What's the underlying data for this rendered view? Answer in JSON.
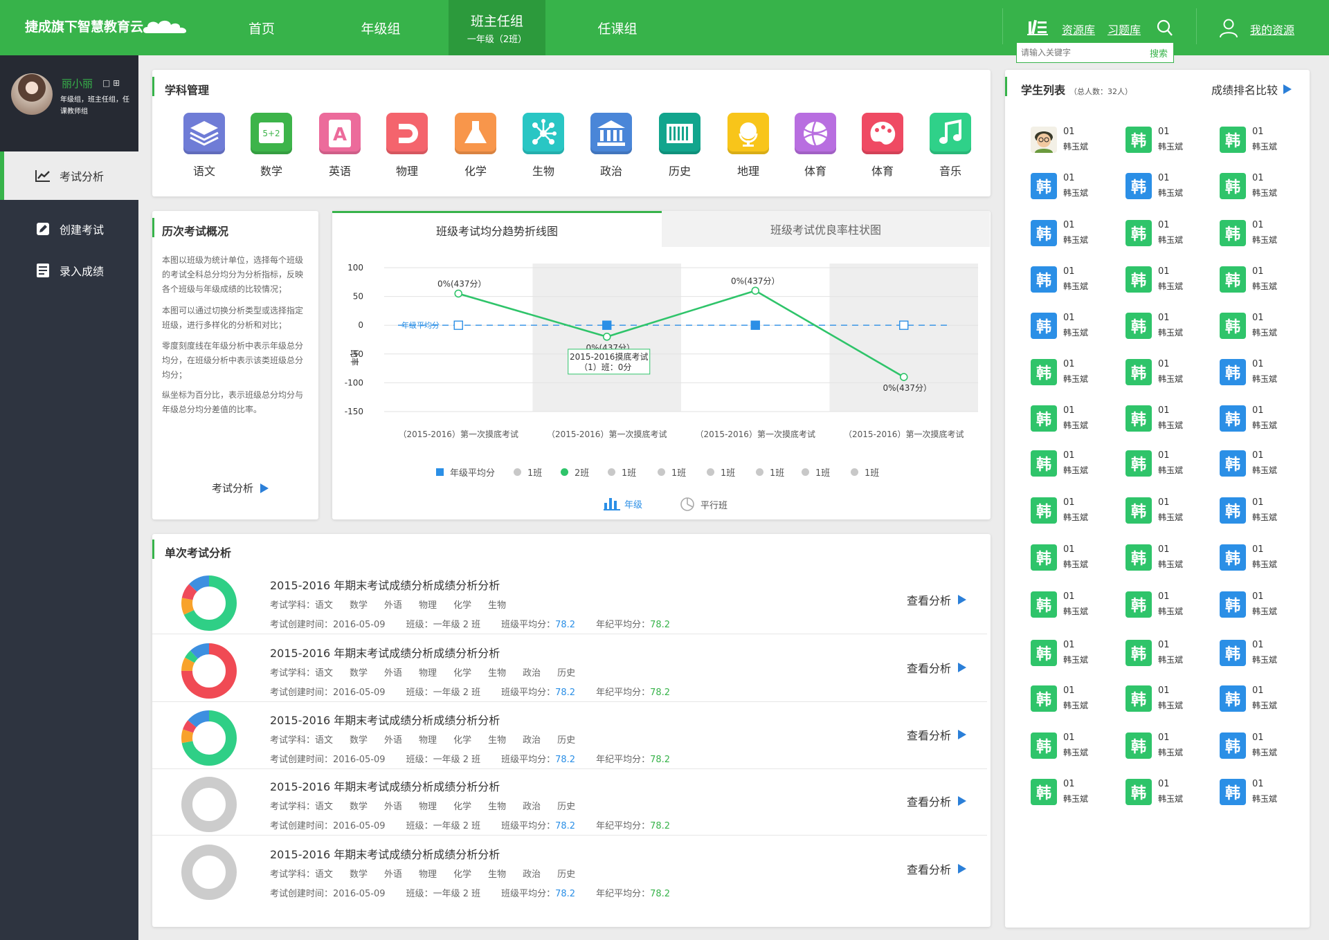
{
  "header": {
    "brand": "捷成旗下智慧教育云",
    "nav": [
      {
        "label": "首页"
      },
      {
        "label": "年级组"
      },
      {
        "label": "班主任组",
        "sub": "一年级（2班）"
      },
      {
        "label": "任课组"
      }
    ],
    "resource_library": "资源库",
    "exercise_library": "习题库",
    "my_resources": "我的资源",
    "search_placeholder": "请输入关键字",
    "search_button": "搜索"
  },
  "sidebar": {
    "user_name": "丽小丽",
    "user_roles": "年级组，班主任组，任课教师组",
    "menu": [
      {
        "label": "考试分析",
        "icon": "trend-chart-icon"
      },
      {
        "label": "创建考试",
        "icon": "edit-icon"
      },
      {
        "label": "录入成绩",
        "icon": "list-icon"
      }
    ]
  },
  "subjects": {
    "title": "学科管理",
    "items": [
      {
        "label": "语文",
        "color": "#6f7cd6"
      },
      {
        "label": "数学",
        "color": "#3db44a"
      },
      {
        "label": "英语",
        "color": "#ec6b9b"
      },
      {
        "label": "物理",
        "color": "#f4646d"
      },
      {
        "label": "化学",
        "color": "#f8964b"
      },
      {
        "label": "生物",
        "color": "#29c6c4"
      },
      {
        "label": "政治",
        "color": "#4a86d8"
      },
      {
        "label": "历史",
        "color": "#12a58d"
      },
      {
        "label": "地理",
        "color": "#f8c51a"
      },
      {
        "label": "体育",
        "color": "#b86ee0"
      },
      {
        "label": "体育",
        "color": "#ef4a63"
      },
      {
        "label": "音乐",
        "color": "#2fd189"
      }
    ]
  },
  "history": {
    "title": "历次考试概况",
    "paragraphs": [
      "本图以班级为统计单位，选择每个班级的考试全科总分均分为分析指标，反映各个班级与年级成绩的比较情况；",
      "本图可以通过切换分析类型或选择指定班级，进行多样化的分析和对比；",
      "零度刻度线在年级分析中表示年级总分均分，在班级分析中表示该类班级总分均分；",
      "纵坐标为百分比，表示班级总分均分与年级总分均分差值的比率。"
    ],
    "link": "考试分析"
  },
  "chart_tabs": [
    "班级考试均分趋势折线图",
    "班级考试优良率柱状图"
  ],
  "chart_data": {
    "type": "line",
    "categories": [
      "（2015-2016）第一次摸底考试",
      "（2015-2016）第一次摸底考试",
      "（2015-2016）第一次摸底考试",
      "（2015-2016）第一次摸底考试"
    ],
    "ylabel": "比率",
    "ylim": [
      -150,
      100
    ],
    "yticks": [
      100,
      50,
      0,
      -50,
      -100,
      -150
    ],
    "series": [
      {
        "name": "年级平均分",
        "values": [
          0,
          0,
          0,
          0
        ],
        "color": "#2b8fe6"
      },
      {
        "name": "2班",
        "values": [
          55,
          -20,
          60,
          -90
        ],
        "color": "#2fc46a"
      }
    ],
    "point_labels": [
      "0%(437分）",
      "0%(437分）",
      "0%(437分）",
      "0%(437分）"
    ],
    "line_label": "年级平均分",
    "tooltip": {
      "title": "2015-2016摸底考试",
      "body": "（1）班：0分"
    },
    "legend": [
      "年级平均分",
      "1班",
      "2班",
      "1班",
      "1班",
      "1班",
      "1班",
      "1班",
      "1班"
    ],
    "toggles": [
      "年级",
      "平行班"
    ]
  },
  "single": {
    "title": "单次考试分析",
    "link": "查看分析",
    "exams": [
      {
        "title": "2015-2016 年期末考试成绩分析成绩分析分析",
        "subjects": [
          "考试学科：语文",
          "数学",
          "外语",
          "物理",
          "化学",
          "生物"
        ],
        "date": "考试创建时间：2016-05-09",
        "cls": "班级：一年级 2 班",
        "class_avg_label": "班级平均分：",
        "class_avg": "78.2",
        "grade_avg_label": "年纪平均分：",
        "grade_avg": "78.2",
        "segments": [
          {
            "v": 0.68,
            "c": "#2fcf86"
          },
          {
            "v": 0.1,
            "c": "#f8a22b"
          },
          {
            "v": 0.09,
            "c": "#ef4a5a"
          },
          {
            "v": 0.13,
            "c": "#3d8fe0"
          }
        ]
      },
      {
        "title": "2015-2016 年期末考试成绩分析成绩分析分析",
        "subjects": [
          "考试学科：语文",
          "数学",
          "外语",
          "物理",
          "化学",
          "生物",
          "政治",
          "历史"
        ],
        "date": "考试创建时间：2016-05-09",
        "cls": "班级：一年级 2 班",
        "class_avg_label": "班级平均分：",
        "class_avg": "78.2",
        "grade_avg_label": "年纪平均分：",
        "grade_avg": "78.2",
        "segments": [
          {
            "v": 0.75,
            "c": "#f04a54"
          },
          {
            "v": 0.08,
            "c": "#f8a22b"
          },
          {
            "v": 0.05,
            "c": "#2fcf86"
          },
          {
            "v": 0.12,
            "c": "#3d8fe0"
          }
        ]
      },
      {
        "title": "2015-2016 年期末考试成绩分析成绩分析分析",
        "subjects": [
          "考试学科：语文",
          "数学",
          "外语",
          "物理",
          "化学",
          "生物",
          "政治",
          "历史"
        ],
        "date": "考试创建时间：2016-05-09",
        "cls": "班级：一年级 2 班",
        "class_avg_label": "班级平均分：",
        "class_avg": "78.2",
        "grade_avg_label": "年纪平均分：",
        "grade_avg": "78.2",
        "segments": [
          {
            "v": 0.72,
            "c": "#2fcf86"
          },
          {
            "v": 0.08,
            "c": "#f8a22b"
          },
          {
            "v": 0.06,
            "c": "#ef4a5a"
          },
          {
            "v": 0.14,
            "c": "#3d8fe0"
          }
        ]
      },
      {
        "title": "2015-2016 年期末考试成绩分析成绩分析分析",
        "subjects": [
          "考试学科：语文",
          "数学",
          "外语",
          "物理",
          "化学",
          "生物",
          "政治",
          "历史"
        ],
        "date": "考试创建时间：2016-05-09",
        "cls": "班级：一年级 2 班",
        "class_avg_label": "班级平均分：",
        "class_avg": "78.2",
        "grade_avg_label": "年纪平均分：",
        "grade_avg": "78.2",
        "segments": [
          {
            "v": 1,
            "c": "#cccccc"
          }
        ]
      },
      {
        "title": "2015-2016 年期末考试成绩分析成绩分析分析",
        "subjects": [
          "考试学科：语文",
          "数学",
          "外语",
          "物理",
          "化学",
          "生物",
          "政治",
          "历史"
        ],
        "date": "考试创建时间：2016-05-09",
        "cls": "班级：一年级 2 班",
        "class_avg_label": "班级平均分：",
        "class_avg": "78.2",
        "grade_avg_label": "年纪平均分：",
        "grade_avg": "78.2",
        "segments": [
          {
            "v": 1,
            "c": "#cccccc"
          }
        ]
      }
    ]
  },
  "students": {
    "title": "学生列表",
    "count": "（总人数：32人）",
    "compare": "成绩排名比较",
    "avatar_char": "韩",
    "number": "01",
    "name": "韩玉斌",
    "colors": [
      "photo",
      "#2fc46a",
      "#2fc46a",
      "#2b8fe6",
      "#2b8fe6",
      "#2fc46a",
      "#2b8fe6",
      "#2fc46a",
      "#2fc46a",
      "#2b8fe6",
      "#2fc46a",
      "#2fc46a",
      "#2b8fe6",
      "#2fc46a",
      "#2fc46a",
      "#2fc46a",
      "#2fc46a",
      "#2b8fe6",
      "#2fc46a",
      "#2fc46a",
      "#2b8fe6",
      "#2fc46a",
      "#2fc46a",
      "#2b8fe6",
      "#2fc46a",
      "#2fc46a",
      "#2b8fe6",
      "#2fc46a",
      "#2fc46a",
      "#2b8fe6",
      "#2fc46a",
      "#2fc46a",
      "#2b8fe6",
      "#2fc46a",
      "#2fc46a",
      "#2b8fe6",
      "#2fc46a",
      "#2fc46a",
      "#2b8fe6",
      "#2fc46a",
      "#2fc46a",
      "#2b8fe6",
      "#2fc46a",
      "#2fc46a",
      "#2b8fe6"
    ]
  }
}
